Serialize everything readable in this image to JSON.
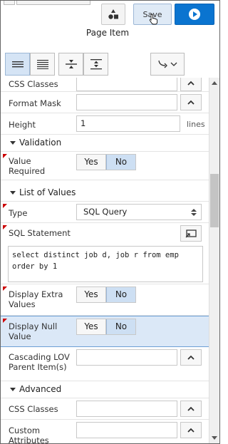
{
  "header": {
    "title": "Page Item",
    "save_label": "Save"
  },
  "toolbar": {
    "buttons": [
      {
        "icon": "show-common-icon",
        "active": true
      },
      {
        "icon": "show-all-icon",
        "active": false
      },
      {
        "icon": "collapse-all-icon",
        "active": false
      },
      {
        "icon": "expand-all-icon",
        "active": false
      },
      {
        "icon": "go-to-group-icon",
        "active": false
      }
    ]
  },
  "props": {
    "css_classes": {
      "label": "CSS Classes",
      "value": ""
    },
    "format_mask": {
      "label": "Format Mask",
      "value": ""
    },
    "height": {
      "label": "Height",
      "value": "1",
      "unit": "lines"
    },
    "validation": {
      "label": "Validation"
    },
    "value_required": {
      "label": "Value Required",
      "yes": "Yes",
      "no": "No",
      "selected": "No"
    },
    "list_of_values": {
      "label": "List of Values"
    },
    "type": {
      "label": "Type",
      "value": "SQL Query"
    },
    "sql_statement": {
      "label": "SQL Statement",
      "value": "select distinct job d, job r from emp order by 1"
    },
    "display_extra": {
      "label": "Display Extra Values",
      "yes": "Yes",
      "no": "No",
      "selected": "No"
    },
    "display_null": {
      "label": "Display Null Value",
      "yes": "Yes",
      "no": "No",
      "selected": "No"
    },
    "cascading": {
      "label": "Cascading LOV Parent Item(s)",
      "value": ""
    },
    "advanced": {
      "label": "Advanced"
    },
    "adv_css_classes": {
      "label": "CSS Classes",
      "value": ""
    },
    "custom_attributes": {
      "label": "Custom Attributes",
      "value": ""
    }
  },
  "colors": {
    "accent": "#0a74d0",
    "selected_row": "#dbe8f7",
    "required_marker": "#cc0000"
  }
}
